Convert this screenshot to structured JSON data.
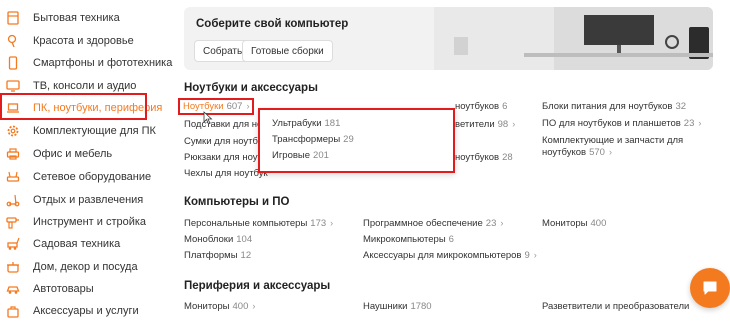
{
  "sidebar": {
    "items": [
      {
        "label": "Бытовая техника",
        "icon": "appliance-icon"
      },
      {
        "label": "Красота и здоровье",
        "icon": "hairdryer-icon"
      },
      {
        "label": "Смартфоны и фототехника",
        "icon": "phone-icon"
      },
      {
        "label": "ТВ, консоли и аудио",
        "icon": "tv-icon"
      },
      {
        "label": "ПК, ноутбуки, периферия",
        "icon": "laptop-icon"
      },
      {
        "label": "Комплектующие для ПК",
        "icon": "gear-icon"
      },
      {
        "label": "Офис и мебель",
        "icon": "printer-icon"
      },
      {
        "label": "Сетевое оборудование",
        "icon": "router-icon"
      },
      {
        "label": "Отдых и развлечения",
        "icon": "scooter-icon"
      },
      {
        "label": "Инструмент и стройка",
        "icon": "drill-icon"
      },
      {
        "label": "Садовая техника",
        "icon": "mower-icon"
      },
      {
        "label": "Дом, декор и посуда",
        "icon": "pot-icon"
      },
      {
        "label": "Автотовары",
        "icon": "car-icon"
      },
      {
        "label": "Аксессуары и услуги",
        "icon": "bag-icon"
      }
    ]
  },
  "banner": {
    "title": "Соберите свой компьютер",
    "btn_build": "Собрать",
    "btn_ready": "Готовые сборки"
  },
  "sections": {
    "laptops": {
      "title": "Ноутбуки и аксессуары",
      "col1": [
        {
          "label": "Ноутбуки",
          "count": "607"
        },
        {
          "label": "Подставки для ноут",
          "count": ""
        },
        {
          "label": "Сумки для ноутбук",
          "count": ""
        },
        {
          "label": "Рюкзаки для ноутб",
          "count": ""
        },
        {
          "label": "Чехлы для ноутбук",
          "count": ""
        }
      ],
      "col2": [
        {
          "label": "ноутбуков",
          "count": "6"
        },
        {
          "label": "ветители",
          "count": "98"
        },
        {
          "label": "",
          "count": ""
        },
        {
          "label": "ноутбуков",
          "count": "28"
        }
      ],
      "col3": [
        {
          "label": "Блоки питания для ноутбуков",
          "count": "32"
        },
        {
          "label": "ПО для ноутбуков и планшетов",
          "count": "23"
        },
        {
          "label": "Комплектующие и запчасти для",
          "count": ""
        },
        {
          "label": "ноутбуков",
          "count": "570"
        }
      ]
    },
    "computers": {
      "title": "Компьютеры и ПО",
      "col1": [
        {
          "label": "Персональные компьютеры",
          "count": "173"
        },
        {
          "label": "Моноблоки",
          "count": "104"
        },
        {
          "label": "Платформы",
          "count": "12"
        }
      ],
      "col2": [
        {
          "label": "Программное обеспечение",
          "count": "23"
        },
        {
          "label": "Микрокомпьютеры",
          "count": "6"
        },
        {
          "label": "Аксессуары для микрокомпьютеров",
          "count": "9"
        }
      ],
      "col3": [
        {
          "label": "Мониторы",
          "count": "400"
        }
      ]
    },
    "peripherals": {
      "title": "Периферия и аксессуары",
      "col1": [
        {
          "label": "Мониторы",
          "count": "400"
        }
      ],
      "col2": [
        {
          "label": "Наушники",
          "count": "1780"
        }
      ],
      "col3": [
        {
          "label": "Разветвители и преобразователи",
          "count": ""
        }
      ]
    }
  },
  "popup": {
    "items": [
      {
        "label": "Ультрабуки",
        "count": "181"
      },
      {
        "label": "Трансформеры",
        "count": "29"
      },
      {
        "label": "Игровые",
        "count": "201"
      }
    ]
  },
  "colors": {
    "accent": "#f47a1f",
    "highlight": "#e21c1c"
  }
}
